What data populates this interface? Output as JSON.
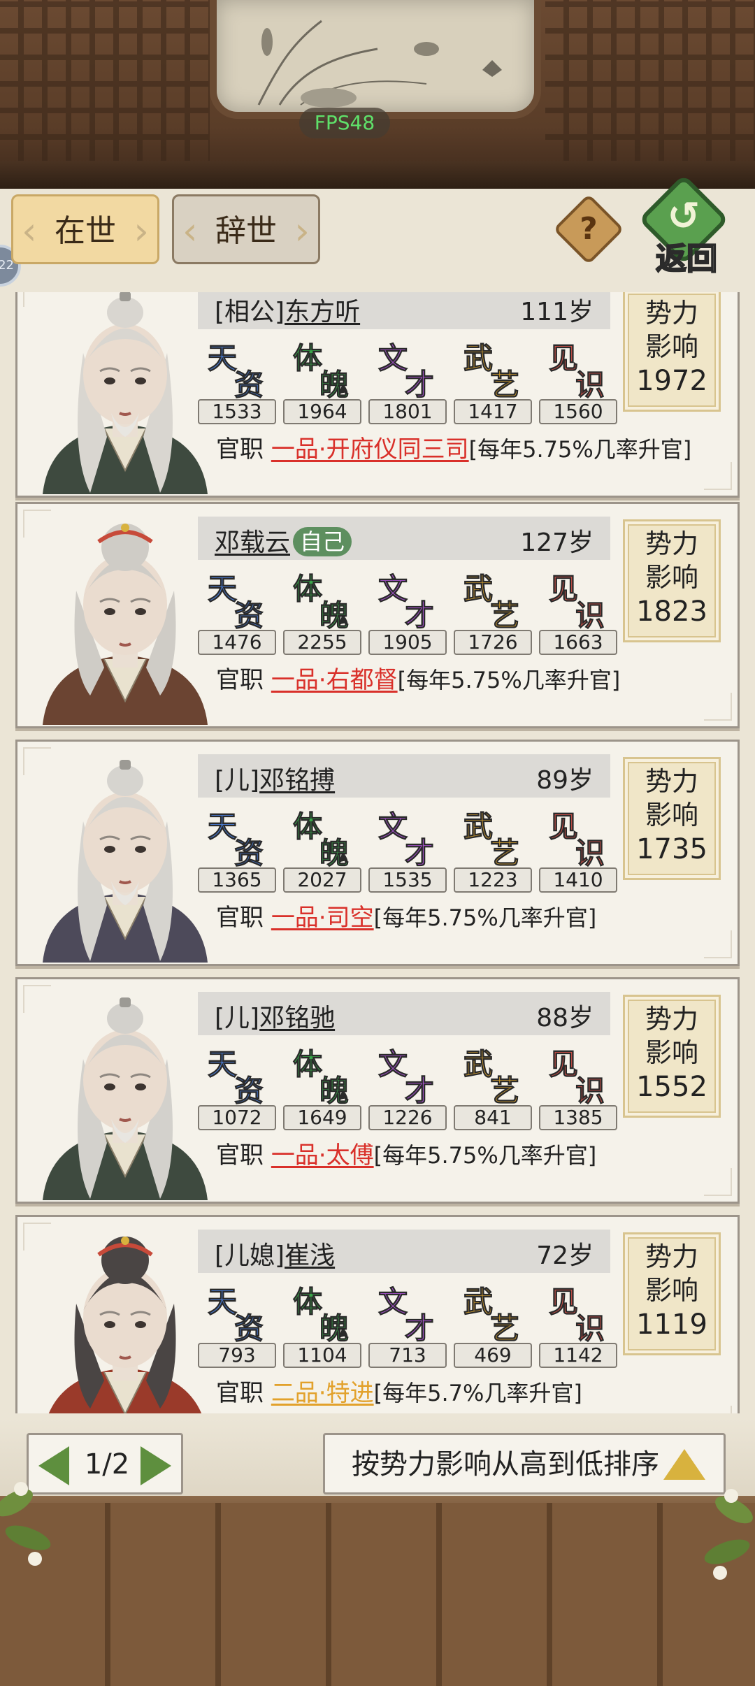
{
  "hud": {
    "fps": "FPS48",
    "side_badge": "22"
  },
  "tabs": [
    {
      "label": "在世",
      "active": true
    },
    {
      "label": "辞世",
      "active": false
    }
  ],
  "header": {
    "help_icon": "question-icon",
    "back_label": "返回",
    "back_icon": "return-arrow-icon"
  },
  "stat_names": [
    {
      "c1": "天",
      "c2": "资",
      "color": "#4a7ed9"
    },
    {
      "c1": "体",
      "c2": "魄",
      "color": "#3aa84a"
    },
    {
      "c1": "文",
      "c2": "才",
      "color": "#a451c9"
    },
    {
      "c1": "武",
      "c2": "艺",
      "color": "#d9a330"
    },
    {
      "c1": "见",
      "c2": "识",
      "color": "#d9534a"
    }
  ],
  "members": [
    {
      "prefix": "[相公]",
      "name": "东方听",
      "self_badge": "",
      "age": "111岁",
      "stats": [
        "1533",
        "1964",
        "1801",
        "1417",
        "1560"
      ],
      "office_label": "官职",
      "rank": "一品·开府仪同三司",
      "rank_color": "red",
      "note": "[每年5.75%几率升官]",
      "power_l1": "势力",
      "power_l2": "影响",
      "power": "1972",
      "portrait": {
        "gender": "male",
        "hair": "#d9d6d0",
        "robe": "#3e4a3f"
      }
    },
    {
      "prefix": "",
      "name": "邓载云",
      "self_badge": "自己",
      "age": "127岁",
      "stats": [
        "1476",
        "2255",
        "1905",
        "1726",
        "1663"
      ],
      "office_label": "官职",
      "rank": "一品·右都督",
      "rank_color": "red",
      "note": "[每年5.75%几率升官]",
      "power_l1": "势力",
      "power_l2": "影响",
      "power": "1823",
      "portrait": {
        "gender": "female",
        "hair": "#cfccc6",
        "robe": "#6b4432"
      }
    },
    {
      "prefix": "[儿]",
      "name": "邓铭搏",
      "self_badge": "",
      "age": "89岁",
      "stats": [
        "1365",
        "2027",
        "1535",
        "1223",
        "1410"
      ],
      "office_label": "官职",
      "rank": "一品·司空",
      "rank_color": "red",
      "note": "[每年5.75%几率升官]",
      "power_l1": "势力",
      "power_l2": "影响",
      "power": "1735",
      "portrait": {
        "gender": "male",
        "hair": "#d6d4cf",
        "robe": "#4d4a5a"
      }
    },
    {
      "prefix": "[儿]",
      "name": "邓铭驰",
      "self_badge": "",
      "age": "88岁",
      "stats": [
        "1072",
        "1649",
        "1226",
        "841",
        "1385"
      ],
      "office_label": "官职",
      "rank": "一品·太傅",
      "rank_color": "red",
      "note": "[每年5.75%几率升官]",
      "power_l1": "势力",
      "power_l2": "影响",
      "power": "1552",
      "portrait": {
        "gender": "male",
        "hair": "#d3d1cc",
        "robe": "#3e4a3f"
      }
    },
    {
      "prefix": "[儿媳]",
      "name": "崔浅",
      "self_badge": "",
      "age": "72岁",
      "stats": [
        "793",
        "1104",
        "713",
        "469",
        "1142"
      ],
      "office_label": "官职",
      "rank": "二品·特进",
      "rank_color": "gold",
      "note": "[每年5.7%几率升官]",
      "power_l1": "势力",
      "power_l2": "影响",
      "power": "1119",
      "portrait": {
        "gender": "female",
        "hair": "#4a4544",
        "robe": "#9a3a2a"
      }
    }
  ],
  "pager": {
    "text": "1/2",
    "prev_icon": "arrow-left-icon",
    "next_icon": "arrow-right-icon"
  },
  "sort": {
    "label": "按势力影响从高到低排序",
    "icon": "triangle-up-icon"
  }
}
